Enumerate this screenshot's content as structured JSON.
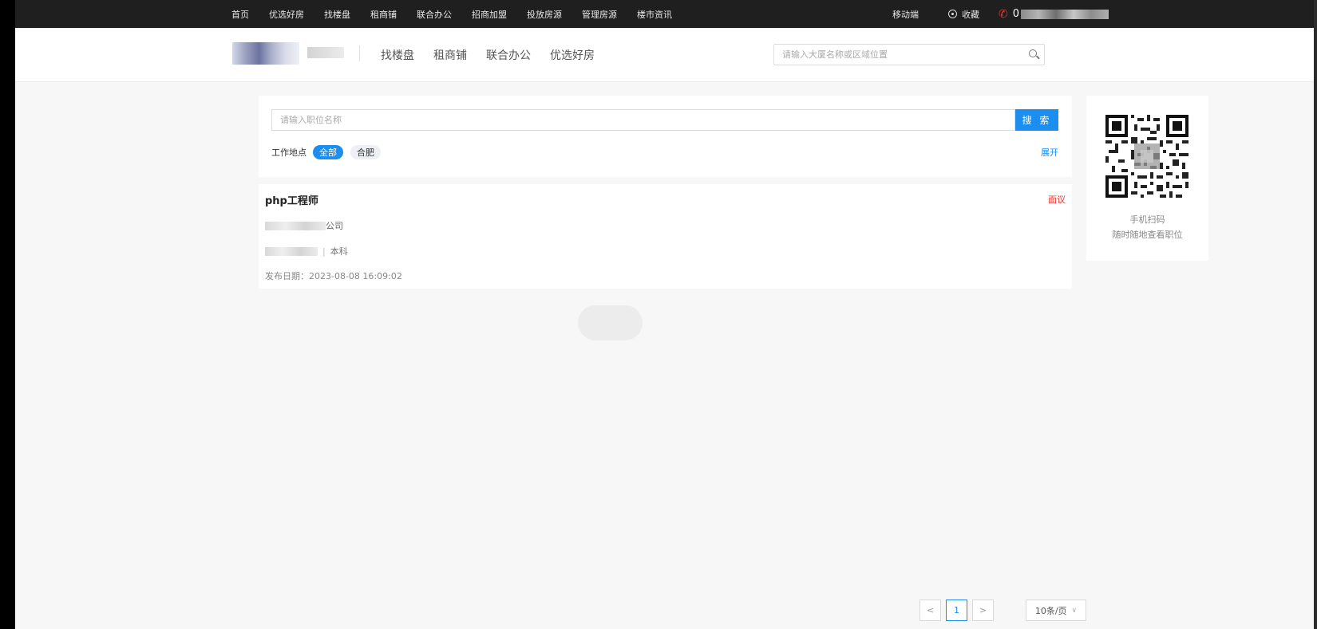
{
  "topbar": {
    "nav": [
      "首页",
      "优选好房",
      "找楼盘",
      "租商铺",
      "联合办公",
      "招商加盟",
      "投放房源",
      "管理房源",
      "楼市资讯"
    ],
    "mobile": "移动端",
    "favorite": "收藏",
    "phone_prefix": "0"
  },
  "header": {
    "nav": [
      "找楼盘",
      "租商铺",
      "联合办公",
      "优选好房"
    ],
    "search_placeholder": "请输入大厦名称或区域位置"
  },
  "filter": {
    "job_placeholder": "请输入职位名称",
    "search_button": "搜 索",
    "location_label": "工作地点",
    "locations": [
      {
        "label": "全部",
        "active": true
      },
      {
        "label": "合肥",
        "active": false
      }
    ],
    "expand": "展开"
  },
  "job": {
    "title": "php工程师",
    "salary": "面议",
    "company_suffix": "公司",
    "education": "本科",
    "date": "发布日期：2023-08-08 16:09:02"
  },
  "qr": {
    "line1": "手机扫码",
    "line2": "随时随地查看职位"
  },
  "pagination": {
    "prev": "<",
    "current": "1",
    "next": ">",
    "page_size": "10条/页"
  },
  "colors": {
    "accent": "#1b8ef0",
    "salary": "#e53935",
    "topbar": "#1f1f1f"
  }
}
